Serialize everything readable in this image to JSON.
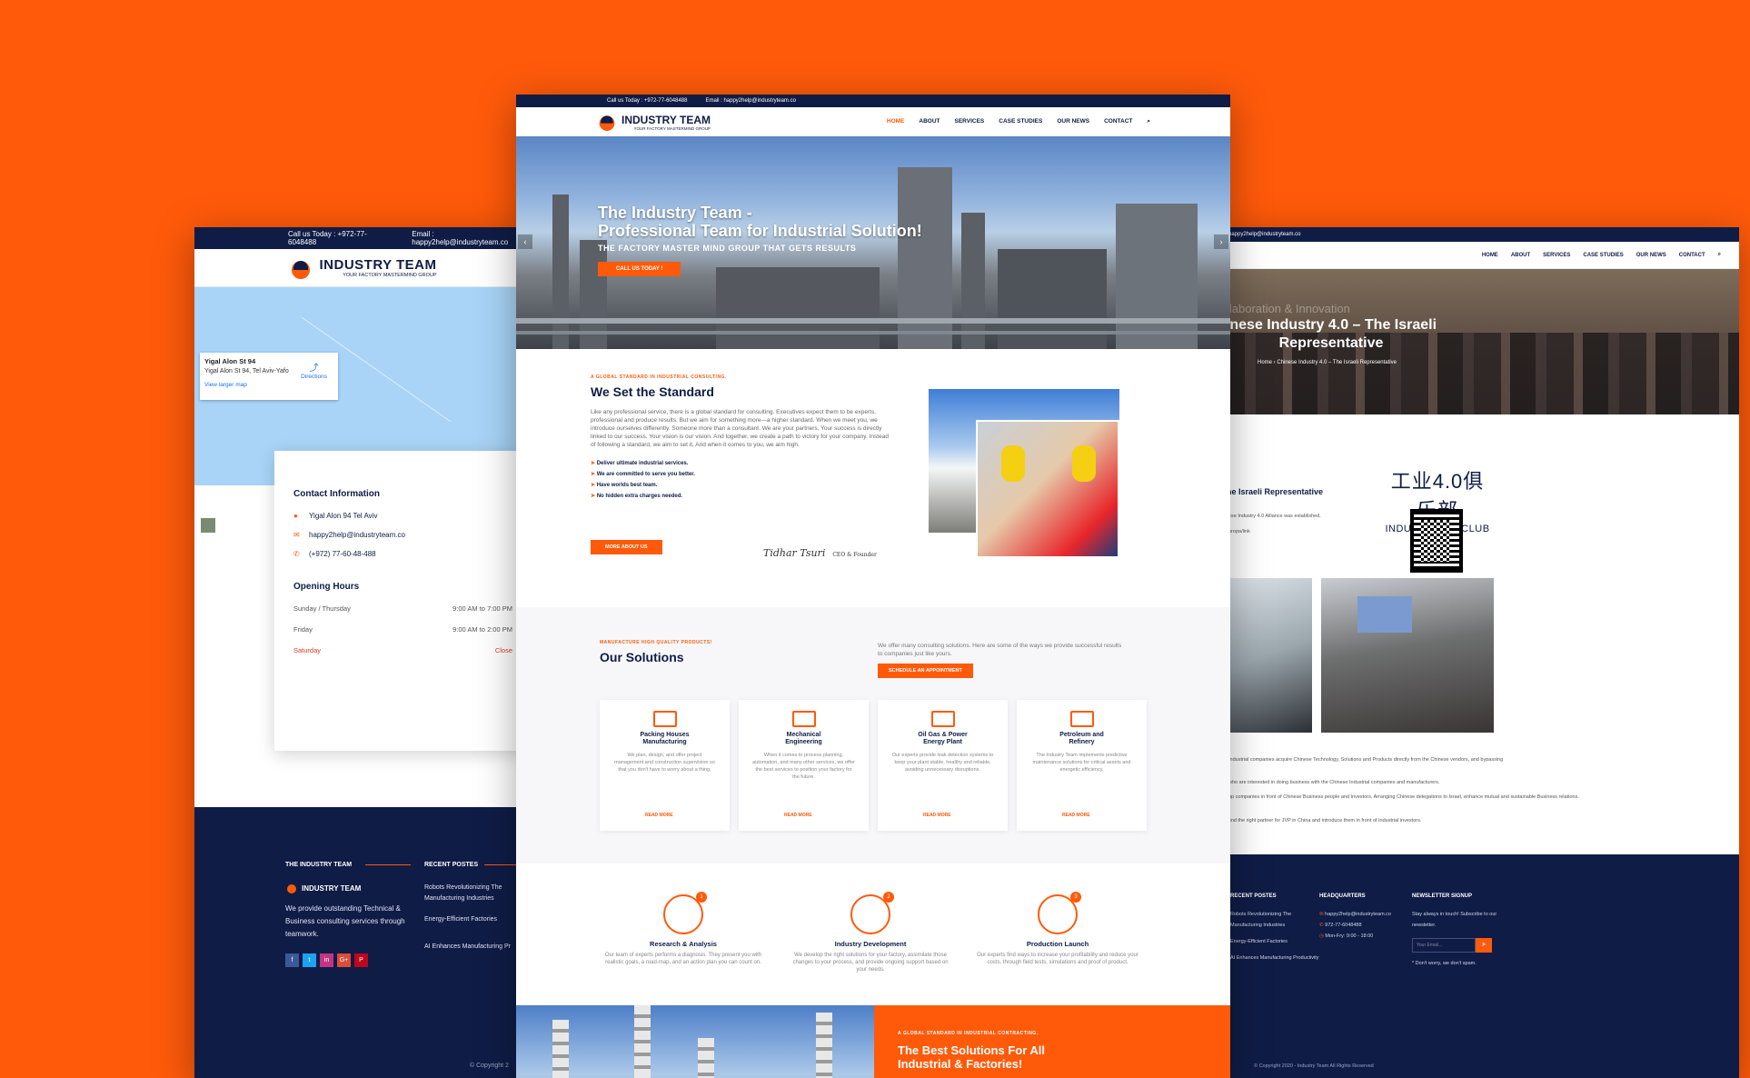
{
  "left": {
    "topbar": {
      "phone": "Call us Today : +972-77-6048488",
      "email": "Email : happy2help@industryteam.co"
    },
    "logo": {
      "name": "INDUSTRY TEAM",
      "tagline": "YOUR FACTORY MASTERMIND GROUP"
    },
    "map_card": {
      "title": "Yigal Alon St 94",
      "address": "Yigal Alon St 94, Tel Aviv-Yafo",
      "directions": "Directions",
      "larger_map": "View larger map"
    },
    "contact": {
      "heading": "Contact Information",
      "address": "Yigal Alon 94 Tel Aviv",
      "email": "happy2help@industryteam.co",
      "phone": "(+972) 77-60-48-488"
    },
    "hours": {
      "heading": "Opening Hours",
      "rows": [
        {
          "day": "Sunday / Thursday",
          "time": "9:00 AM to 7:00 PM"
        },
        {
          "day": "Friday",
          "time": "9:00 AM to 2:00 PM"
        },
        {
          "day": "Saturday",
          "time": "Close"
        }
      ]
    },
    "footer": {
      "col1_title": "THE INDUSTRY TEAM",
      "about": "We provide outstanding Technical & Business consulting services through teamwork.",
      "col2_title": "RECENT POSTES",
      "posts": [
        "Robots Revolutionizing The Manufacturing Industries",
        "Energy-Efficient Factories",
        "AI Enhances Manufacturing Pr"
      ],
      "social": [
        "f",
        "t",
        "in",
        "G+",
        "P"
      ],
      "copyright": "© Copyright 2"
    }
  },
  "center": {
    "topbar": {
      "phone": "Call us Today : +972-77-6048488",
      "email": "Email : happy2help@industryteam.co"
    },
    "logo": {
      "name": "INDUSTRY TEAM",
      "tagline": "YOUR FACTORY MASTERMIND GROUP"
    },
    "nav": [
      "HOME",
      "ABOUT",
      "SERVICES",
      "CASE STUDIES",
      "OUR NEWS",
      "CONTACT"
    ],
    "hero": {
      "title_line1": "The Industry Team -",
      "title_line2": "Professional Team for Industrial Solution!",
      "subtitle": "THE FACTORY MASTER MIND GROUP THAT GETS RESULTS",
      "button": "CALL US TODAY !"
    },
    "standard": {
      "eyebrow": "A GLOBAL STANDARD IN INDUSTRIAL CONSULTING.",
      "title": "We Set the Standard",
      "body": "Like any professional service, there is a global standard for consulting. Executives expect them to be experts, professional and produce results. But we aim for something more—a higher standard. When we meet you, we introduce ourselves differently. Someone more than a consultant. We are your partners. Your success is directly linked to our success. Your vision is our vision. And together, we create a path to victory for your company. Instead of following a standard, we aim to set it. And when it comes to you, we aim high.",
      "checks": [
        "Deliver ultimate industrial services.",
        "We are committed to serve you better.",
        "Have worlds best team.",
        "No hidden extra charges needed."
      ],
      "button": "MORE ABOUT US",
      "signature": "Tidhar Tsuri",
      "role": "CEO & Founder"
    },
    "solutions": {
      "eyebrow": "MANUFACTURE HIGH QUALITY PRODUCTS!",
      "title": "Our Solutions",
      "intro": "We offer many consulting solutions. Here are some of the ways we provide successful results to companies just like yours.",
      "button": "SCHEDULE AN APPOINTMENT",
      "read_more": "READ MORE",
      "cards": [
        {
          "title_line1": "Packing Houses",
          "title_line2": "Manufacturing",
          "text": "We plan, design, and offer project management and construction supervision so that you don't have to worry about a thing."
        },
        {
          "title_line1": "Mechanical",
          "title_line2": "Engineering",
          "text": "When it comes to process planning, automation, and many other services, we offer the best services to position your factory for the future."
        },
        {
          "title_line1": "Oil Gas & Power",
          "title_line2": "Energy Plant",
          "text": "Our experts provide leak detection systems to keep your plant stable, healthy and reliable, avoiding unnecessary disruptions."
        },
        {
          "title_line1": "Petroleum and",
          "title_line2": "Refinery",
          "text": "The Industry Team implements predictive maintenance solutions for critical assets and energetic efficiency."
        }
      ]
    },
    "steps": [
      {
        "num": "1",
        "title": "Research & Analysis",
        "text": "Our team of experts performs a diagnosis. They present you with realistic goals, a road-map, and an action plan you can count on."
      },
      {
        "num": "2",
        "title": "Industry Development",
        "text": "We develop the right solutions for your factory, assimilate those changes to your process, and provide ongoing support based on your needs."
      },
      {
        "num": "3",
        "title": "Production Launch",
        "text": "Our experts find ways to increase your profitability and reduce your costs, through field tests, simulations and proof of product."
      }
    ],
    "bottom": {
      "eyebrow": "A GLOBAL STANDARD IN INDUSTRIAL CONTRACTING.",
      "title_line1": "The Best Solutions For All",
      "title_line2": "Industrial & Factories!"
    }
  },
  "right": {
    "topbar": "happy2help@industryteam.co",
    "nav": [
      "HOME",
      "ABOUT",
      "SERVICES",
      "CASE STUDIES",
      "OUR NEWS",
      "CONTACT"
    ],
    "hero": {
      "faded": "llaboration & Innovation",
      "title": "inese Industry 4.0 – The Israeli Representative",
      "breadcrumb": "Home › Chinese Industry 4.0 – The Israeli Representative"
    },
    "club": {
      "cn": "工业4.0俱乐部",
      "en": "INDUSTRY 4.0 CLUB"
    },
    "rep_heading": "he Israeli Representative",
    "small_lines": [
      "ese Industry 4.0 Alliance was established.",
      "uropa/link",
      "Industrial companies acquire Chinese Technology, Solutions and Products directly from the Chinese vendors, and bypassing",
      "who are interested in doing business with the Chinese Industrial companies and manufacturers.",
      "up companies in front of Chinese Business people and Investors. Arranging Chinese delegations to Israel, enhance mutual and sustainable Business relations.",
      "find the right partner for JVP in China and introduce them in front of Industrial investors."
    ],
    "footer": {
      "recent_title": "RECENT POSTES",
      "posts": [
        "Robots Revolutionizing The Manufacturing Industries",
        "Energy-Efficient Factories",
        "AI Enhances Manufacturing Productivity"
      ],
      "hq_title": "HEADQUARTERS",
      "hq": [
        "happy2help@industryteam.co",
        "972-77-6048488",
        "Mon-Fry: 9:00 - 18:00"
      ],
      "news_title": "NEWSLETTER SIGNUP",
      "news_text": "Stay always in touch! Subscribe to our newsletter.",
      "email_placeholder": "Your Email...",
      "spam": "* Don't worry, we don't spam.",
      "copyright": "© Copyright 2020 - Industry Team All Rights Reserved"
    }
  },
  "colors": {
    "accent": "#ff5a0a",
    "navy": "#0f1c46"
  }
}
